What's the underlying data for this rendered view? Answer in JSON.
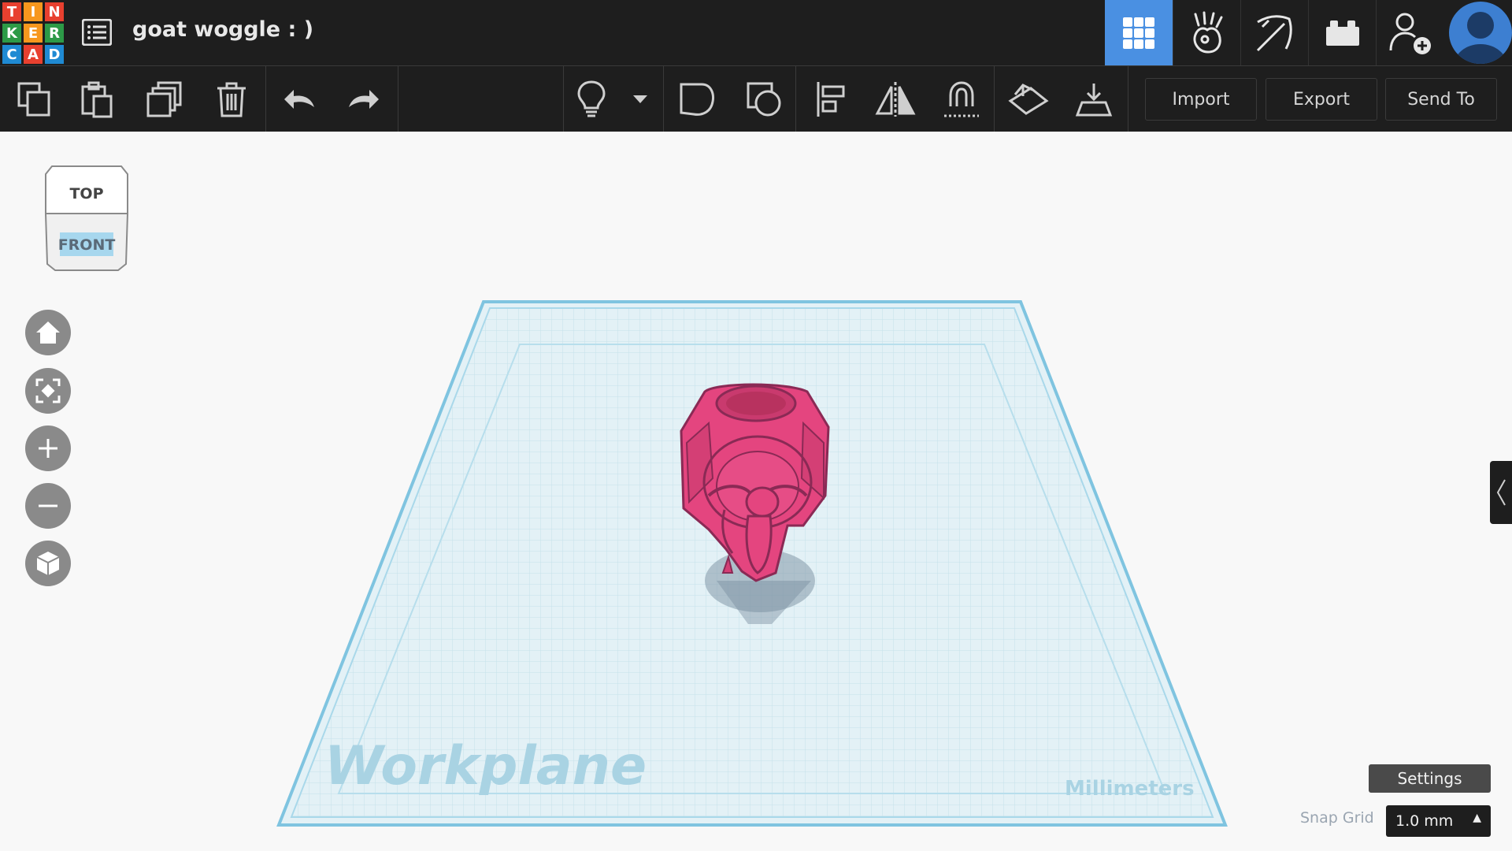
{
  "app": {
    "logo_letters": [
      "T",
      "I",
      "N",
      "K",
      "E",
      "R",
      "C",
      "A",
      "D"
    ],
    "logo_colors": [
      "#e8402f",
      "#f7971d",
      "#e8402f",
      "#2d9a47",
      "#f7971d",
      "#2d9a47",
      "#1f8ad3",
      "#e8402f",
      "#1f8ad3"
    ],
    "design_title": "goat woggle : )"
  },
  "mode_tabs": [
    {
      "name": "3d-design",
      "icon": "grid-icon",
      "active": true
    },
    {
      "name": "codeblocks",
      "icon": "codeblocks-icon",
      "active": false
    },
    {
      "name": "minecraft",
      "icon": "pickaxe-icon",
      "active": false
    },
    {
      "name": "lego",
      "icon": "brick-icon",
      "active": false
    },
    {
      "name": "invite",
      "icon": "add-user-icon",
      "active": false
    }
  ],
  "toolbar": {
    "import_label": "Import",
    "export_label": "Export",
    "send_to_label": "Send To"
  },
  "viewcube": {
    "top_label": "TOP",
    "front_label": "FRONT"
  },
  "workplane": {
    "label": "Workplane",
    "units_label": "Millimeters"
  },
  "bottom_right": {
    "settings_label": "Settings",
    "snap_grid_label": "Snap Grid",
    "snap_grid_value": "1.0 mm"
  },
  "colors": {
    "accent": "#4a90e2",
    "shape_pink": "#e8407c",
    "workplane_fill": "#dff0f5",
    "workplane_edge": "#8fcde6"
  }
}
